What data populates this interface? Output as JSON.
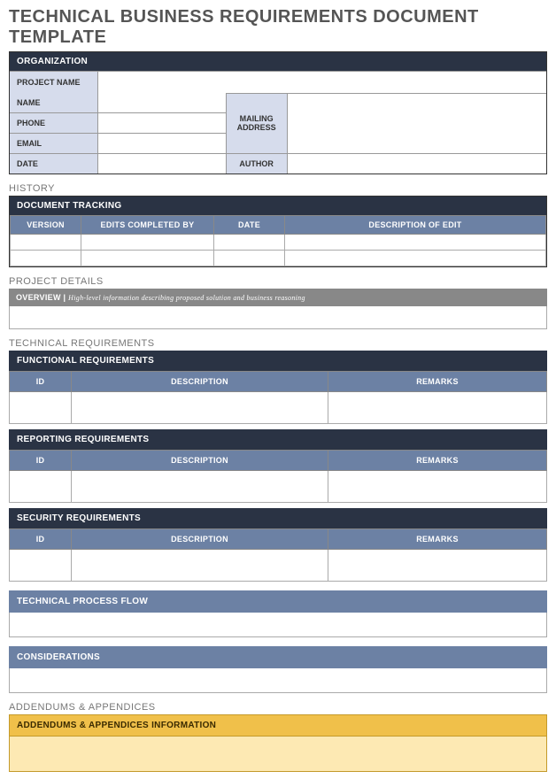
{
  "title": "TECHNICAL BUSINESS REQUIREMENTS DOCUMENT TEMPLATE",
  "org": {
    "header": "ORGANIZATION",
    "project_name_label": "PROJECT NAME",
    "name_label": "NAME",
    "phone_label": "PHONE",
    "email_label": "EMAIL",
    "date_label": "DATE",
    "mailing_label": "MAILING ADDRESS",
    "author_label": "AUTHOR"
  },
  "history": {
    "label": "HISTORY",
    "header": "DOCUMENT TRACKING",
    "cols": {
      "version": "VERSION",
      "edits": "EDITS COMPLETED BY",
      "date": "DATE",
      "desc": "DESCRIPTION OF EDIT"
    }
  },
  "project_details": {
    "label": "PROJECT DETAILS",
    "overview_label": "OVERVIEW",
    "overview_sep": " | ",
    "overview_hint": "High-level information describing proposed solution and business reasoning"
  },
  "tech": {
    "label": "TECHNICAL REQUIREMENTS",
    "functional_header": "FUNCTIONAL REQUIREMENTS",
    "reporting_header": "REPORTING REQUIREMENTS",
    "security_header": "SECURITY REQUIREMENTS",
    "cols": {
      "id": "ID",
      "desc": "DESCRIPTION",
      "remarks": "REMARKS"
    },
    "process_flow_header": "TECHNICAL PROCESS FLOW",
    "considerations_header": "CONSIDERATIONS"
  },
  "addendums": {
    "label": "ADDENDUMS & APPENDICES",
    "header": "ADDENDUMS & APPENDICES INFORMATION"
  }
}
